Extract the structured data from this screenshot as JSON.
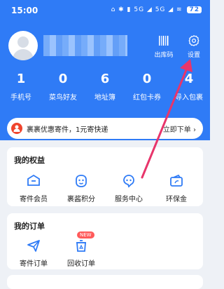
{
  "status": {
    "time": "15:00",
    "icons_text": "⌂ ✱ ▮ 5G ◢ 5G ◢ ≋",
    "battery": "72"
  },
  "header": {
    "bg_color": "#2f7bf6",
    "username": "",
    "buttons": [
      {
        "name": "barcode-icon",
        "label": "出库码"
      },
      {
        "name": "gear-icon",
        "label": "设置"
      }
    ]
  },
  "stats": [
    {
      "value": "1",
      "label": "手机号"
    },
    {
      "value": "0",
      "label": "菜鸟好友"
    },
    {
      "value": "6",
      "label": "地址簿"
    },
    {
      "value": "0",
      "label": "红包卡券"
    },
    {
      "value": "4",
      "label": "导入包裹"
    }
  ],
  "promo": {
    "text": "裹裹优惠寄件，1元寄快递",
    "button": "立即下单 ›"
  },
  "benefits": {
    "title": "我的权益",
    "items": [
      {
        "icon": "member-icon",
        "label": "寄件会员"
      },
      {
        "icon": "points-icon",
        "label": "裹酱积分"
      },
      {
        "icon": "service-icon",
        "label": "服务中心"
      },
      {
        "icon": "eco-icon",
        "label": "环保金"
      }
    ]
  },
  "orders": {
    "title": "我的订单",
    "items": [
      {
        "icon": "send-icon",
        "label": "寄件订单",
        "badge": ""
      },
      {
        "icon": "recycle-icon",
        "label": "回收订单",
        "badge": "NEW"
      }
    ]
  },
  "colors": {
    "accent": "#2f7bf6",
    "arrow": "#e8356b",
    "promo_icon": "#f0442c"
  }
}
